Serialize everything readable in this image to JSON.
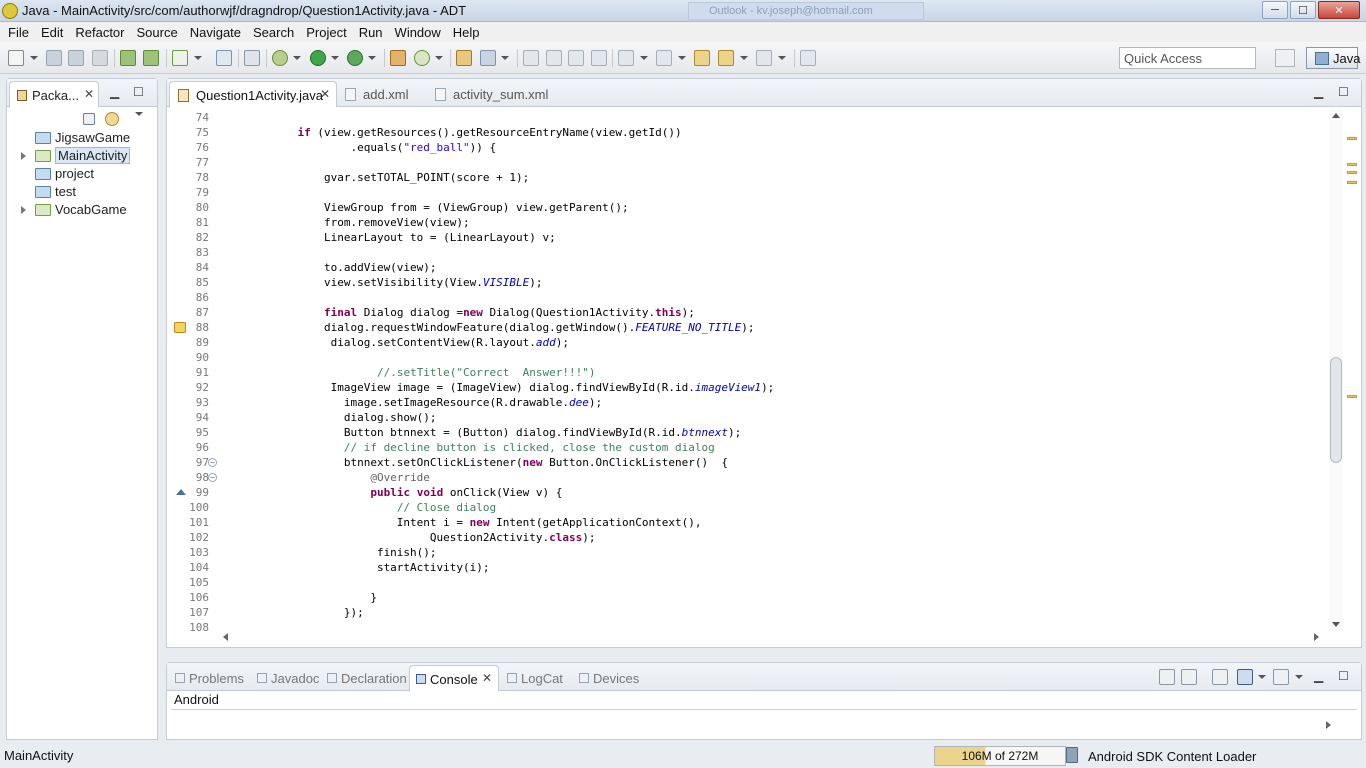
{
  "window": {
    "title": "Java - MainActivity/src/com/authorwjf/dragndrop/Question1Activity.java - ADT",
    "ghost_tab": "Outlook - kv.joseph@hotmail.com",
    "minimize": "─",
    "maximize": "☐",
    "close": "✕"
  },
  "menu": [
    "File",
    "Edit",
    "Refactor",
    "Source",
    "Navigate",
    "Search",
    "Project",
    "Run",
    "Window",
    "Help"
  ],
  "toolbar": {
    "quick_access_placeholder": "Quick Access",
    "perspective": "Java"
  },
  "package_explorer": {
    "tab_label": "Packa...",
    "close": "✕",
    "items": [
      {
        "label": "JigsawGame",
        "expandable": false,
        "icon": "folder-icon"
      },
      {
        "label": "MainActivity",
        "expandable": true,
        "icon": "android-project-icon",
        "selected": true
      },
      {
        "label": "project",
        "expandable": false,
        "icon": "folder-icon"
      },
      {
        "label": "test",
        "expandable": false,
        "icon": "folder-icon"
      },
      {
        "label": "VocabGame",
        "expandable": true,
        "icon": "android-project-icon"
      }
    ]
  },
  "editor": {
    "tabs": [
      {
        "label": "Question1Activity.java",
        "active": true,
        "closable": true
      },
      {
        "label": "add.xml",
        "active": false
      },
      {
        "label": "activity_sum.xml",
        "active": false
      }
    ],
    "lines": [
      {
        "n": "74",
        "code": ""
      },
      {
        "n": "75",
        "code": "            if (view.getResources().getResourceEntryName(view.getId())"
      },
      {
        "n": "76",
        "code": "                    .equals(\"red_ball\")) {"
      },
      {
        "n": "77",
        "code": ""
      },
      {
        "n": "78",
        "code": "                gvar.setTOTAL_POINT(score + 1);"
      },
      {
        "n": "79",
        "code": ""
      },
      {
        "n": "80",
        "code": "                ViewGroup from = (ViewGroup) view.getParent();"
      },
      {
        "n": "81",
        "code": "                from.removeView(view);"
      },
      {
        "n": "82",
        "code": "                LinearLayout to = (LinearLayout) v;"
      },
      {
        "n": "83",
        "code": ""
      },
      {
        "n": "84",
        "code": "                to.addView(view);"
      },
      {
        "n": "85",
        "code": "                view.setVisibility(View.VISIBLE);"
      },
      {
        "n": "86",
        "code": ""
      },
      {
        "n": "87",
        "code": "                final Dialog dialog =new Dialog(Question1Activity.this);"
      },
      {
        "n": "88",
        "code": "                dialog.requestWindowFeature(dialog.getWindow().FEATURE_NO_TITLE);"
      },
      {
        "n": "89",
        "code": "                 dialog.setContentView(R.layout.add);"
      },
      {
        "n": "90",
        "code": ""
      },
      {
        "n": "91",
        "code": "                        //.setTitle(\"Correct  Answer!!!\")"
      },
      {
        "n": "92",
        "code": "                 ImageView image = (ImageView) dialog.findViewById(R.id.imageView1);"
      },
      {
        "n": "93",
        "code": "                   image.setImageResource(R.drawable.dee);"
      },
      {
        "n": "94",
        "code": "                   dialog.show();"
      },
      {
        "n": "95",
        "code": "                   Button btnnext = (Button) dialog.findViewById(R.id.btnnext);"
      },
      {
        "n": "96",
        "code": "                   // if decline button is clicked, close the custom dialog"
      },
      {
        "n": "97",
        "code": "                   btnnext.setOnClickListener(new Button.OnClickListener()  {"
      },
      {
        "n": "98",
        "code": "                       @Override"
      },
      {
        "n": "99",
        "code": "                       public void onClick(View v) {"
      },
      {
        "n": "100",
        "code": "                           // Close dialog"
      },
      {
        "n": "101",
        "code": "                           Intent i = new Intent(getApplicationContext(),"
      },
      {
        "n": "102",
        "code": "                                Question2Activity.class);"
      },
      {
        "n": "103",
        "code": "                        finish();"
      },
      {
        "n": "104",
        "code": "                        startActivity(i);"
      },
      {
        "n": "105",
        "code": ""
      },
      {
        "n": "106",
        "code": "                       }"
      },
      {
        "n": "107",
        "code": "                   });"
      },
      {
        "n": "108",
        "code": ""
      }
    ],
    "markers": {
      "warning_line": "88",
      "override_line": "99",
      "fold_lines": [
        "97",
        "98"
      ]
    }
  },
  "bottom_panel": {
    "tabs": [
      {
        "label": "Problems",
        "active": false
      },
      {
        "label": "Javadoc",
        "active": false
      },
      {
        "label": "Declaration",
        "active": false
      },
      {
        "label": "Console",
        "active": true
      },
      {
        "label": "LogCat",
        "active": false
      },
      {
        "label": "Devices",
        "active": false
      }
    ],
    "console_text": "Android"
  },
  "status": {
    "left": "MainActivity",
    "heap": "106M of 272M",
    "heap_fraction": 0.39,
    "loader": "Android SDK Content Loader"
  },
  "colors": {
    "keyword": "#7f0055",
    "string": "#2a00ff",
    "comment": "#3f7f5f",
    "field": "#0000c0",
    "annotation": "#646464"
  }
}
